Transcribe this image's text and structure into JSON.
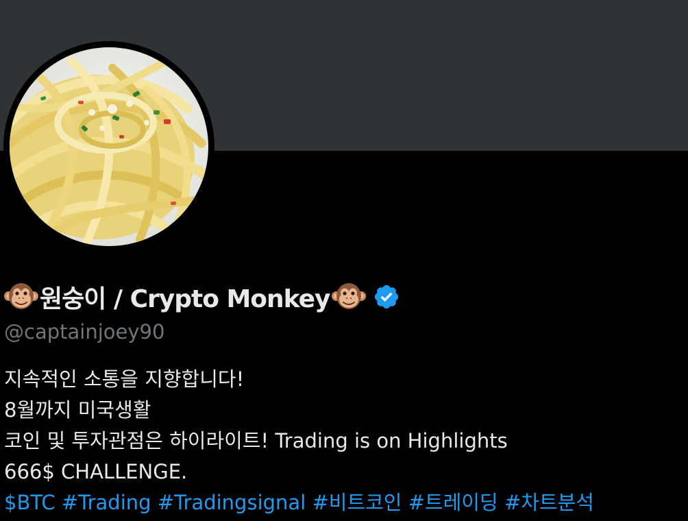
{
  "colors": {
    "banner": "#303336",
    "page_background": "#000000",
    "text_primary": "#e7e9ea",
    "text_secondary": "#71767b",
    "link": "#1d9bf0",
    "verified_badge": "#1d9bf0"
  },
  "profile": {
    "avatar_icon": "avatar-image",
    "name_prefix_emoji": "🐵",
    "display_name": "원숭이 / Crypto Monkey",
    "name_suffix_emoji": "🐵",
    "verified_icon": "verified-badge-icon",
    "handle": "@captainjoey90"
  },
  "bio": {
    "lines": [
      "지속적인 소통을 지향합니다!",
      "8월까지 미국생활",
      "코인 및 투자관점은 하이라이트! Trading is on Highlights",
      "666$ CHALLENGE."
    ],
    "tags": [
      "$BTC",
      "#Trading",
      "#Tradingsignal",
      "#비트코인",
      "#트레이딩",
      "#차트분석"
    ]
  }
}
